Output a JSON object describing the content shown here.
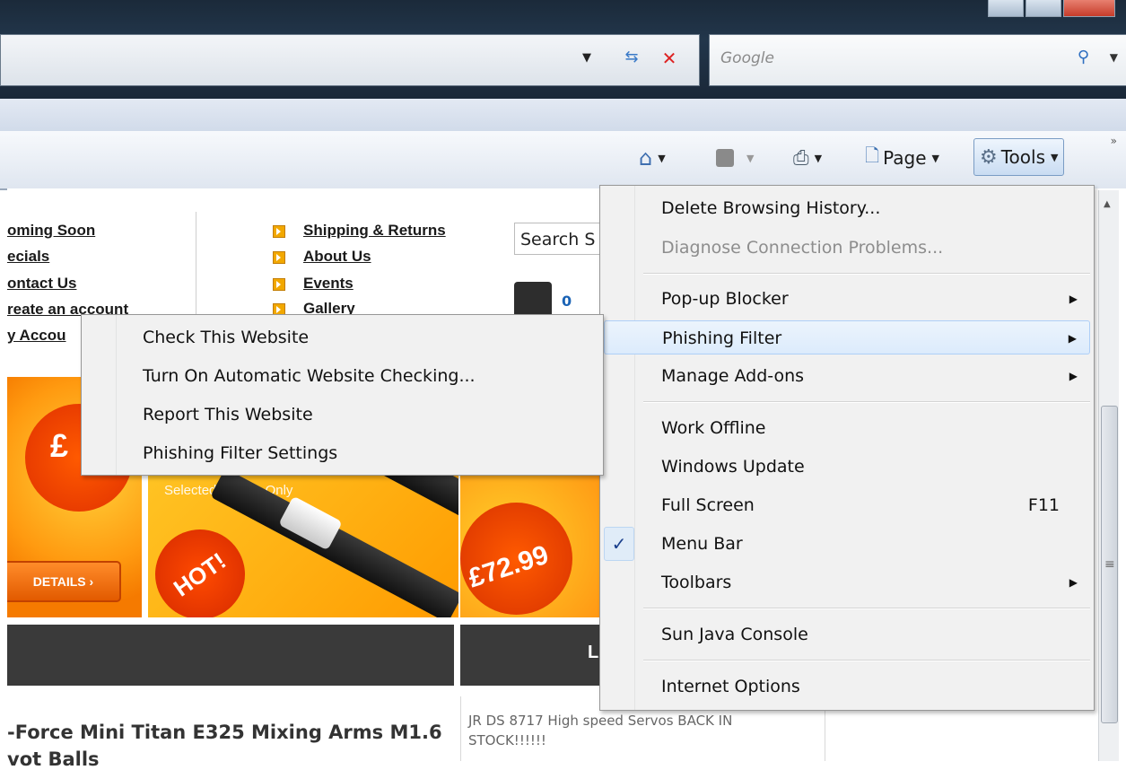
{
  "browser": {
    "search_placeholder": "Google",
    "command_bar": {
      "page_label": "Page",
      "tools_label": "Tools"
    }
  },
  "page": {
    "left_links": [
      "oming Soon",
      "ecials",
      "ontact Us",
      "reate an account",
      "y Accou"
    ],
    "right_links": [
      "Shipping & Returns",
      "About Us",
      "Events",
      "Gallery"
    ],
    "search_placeholder": "Search S",
    "basket_count": "0",
    "banners": {
      "banner1_price": "£",
      "details_button": "DETAILS  ›",
      "banner2_subtitle": "Selected Blades Only",
      "banner2_badge": "HOT!",
      "banner3_price": "£72.99"
    },
    "band_label": "LA",
    "product_title_line1": "-Force Mini Titan E325 Mixing Arms M1.6",
    "product_title_line2": "vot Balls",
    "news_item": "JR DS 8717 High speed Servos BACK IN STOCK!!!!!!"
  },
  "tools_menu": {
    "items": [
      {
        "label": "Delete Browsing History...",
        "enabled": true
      },
      {
        "label": "Diagnose Connection Problems...",
        "enabled": false
      },
      {
        "label": "Pop-up Blocker",
        "submenu": true
      },
      {
        "label": "Phishing Filter",
        "submenu": true,
        "highlighted": true
      },
      {
        "label": "Manage Add-ons",
        "submenu": true
      },
      {
        "label": "Work Offline"
      },
      {
        "label": "Windows Update"
      },
      {
        "label": "Full Screen",
        "shortcut": "F11"
      },
      {
        "label": "Menu Bar",
        "checked": true
      },
      {
        "label": "Toolbars",
        "submenu": true
      },
      {
        "label": "Sun Java Console"
      },
      {
        "label": "Internet Options"
      }
    ]
  },
  "phishing_submenu": {
    "items": [
      {
        "label": "Check This Website"
      },
      {
        "label": "Turn On Automatic Website Checking..."
      },
      {
        "label": "Report This Website"
      },
      {
        "label": "Phishing Filter Settings"
      }
    ]
  }
}
